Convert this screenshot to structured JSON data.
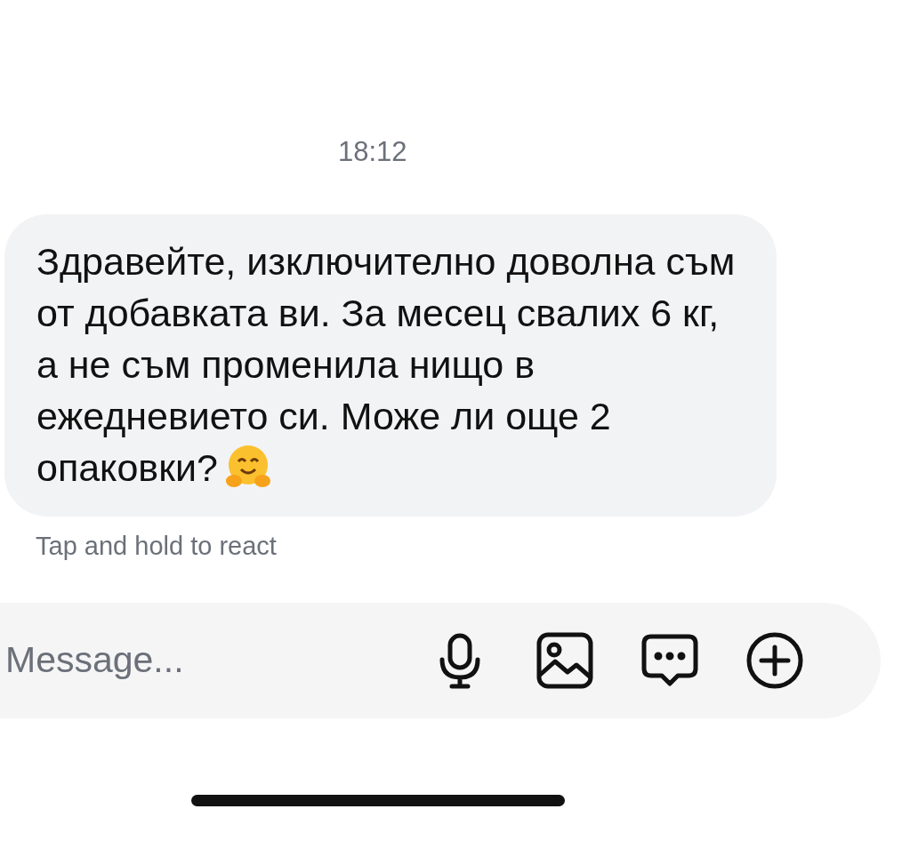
{
  "timestamp": "18:12",
  "message": {
    "text": "Здравейте, изключително доволна съм от добавката ви. За месец свалих 6 кг, а не съм променила нищо в ежедневието си. Може ли още 2 опаковки?"
  },
  "hint": "Tap and hold to react",
  "composer": {
    "placeholder": "Message..."
  }
}
